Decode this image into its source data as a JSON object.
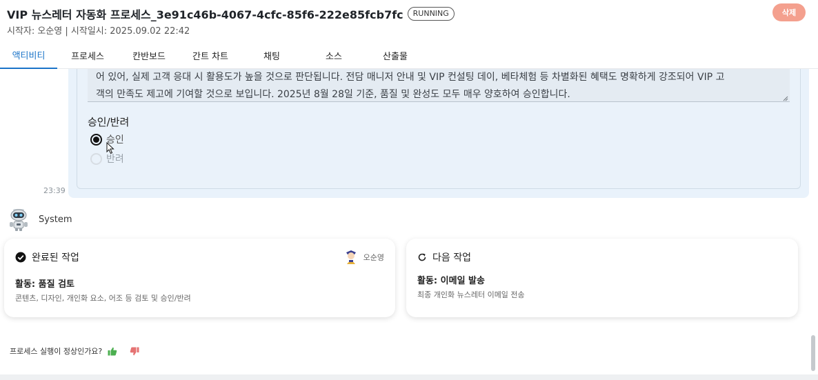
{
  "header": {
    "title": "VIP 뉴스레터 자동화 프로세스_3e91c46b-4067-4cfc-85f6-222e85fcb7fc",
    "status": "RUNNING",
    "subtitle": "시작자: 오순영 | 시작일시: 2025.09.02 22:42",
    "delete_label": "삭제"
  },
  "tabs": [
    {
      "label": "액티비티",
      "active": true
    },
    {
      "label": "프로세스",
      "active": false
    },
    {
      "label": "칸반보드",
      "active": false
    },
    {
      "label": "간트 차트",
      "active": false
    },
    {
      "label": "채팅",
      "active": false
    },
    {
      "label": "소스",
      "active": false
    },
    {
      "label": "산출물",
      "active": false
    }
  ],
  "review_form": {
    "text_line_1": "어 있어, 실제 고객 응대 시 활용도가 높을 것으로 판단됩니다. 전담 매니저 안내 및 VIP 컨설팅 데이, 베타체험 등 차별화된 혜택도 명확하게 강조되어 VIP 고",
    "text_line_2": "객의 만족도 제고에 기여할 것으로 보입니다. 2025년 8월 28일 기준, 품질 및 완성도 모두 매우 양호하여 승인합니다.",
    "decision_label": "승인/반려",
    "options": [
      {
        "label": "승인",
        "selected": true
      },
      {
        "label": "반려",
        "selected": false
      }
    ],
    "timestamp": "23:39"
  },
  "system": {
    "name": "System"
  },
  "completed_task": {
    "heading": "완료된 작업",
    "assignee": "오순영",
    "activity": "활동: 품질 검토",
    "description": "콘텐츠, 디자인, 개인화 요소, 어조 등 검토 및 승인/반려"
  },
  "next_task": {
    "heading": "다음 작업",
    "activity": "활동: 이메일 발송",
    "description": "최종 개인화 뉴스레터 이메일 전송"
  },
  "feedback": {
    "question": "프로세스 실행이 정상인가요?"
  },
  "colors": {
    "accent": "#1a73c8",
    "delete": "#f4a08e",
    "thumb_up": "#4caf50",
    "thumb_down": "#e57373"
  }
}
